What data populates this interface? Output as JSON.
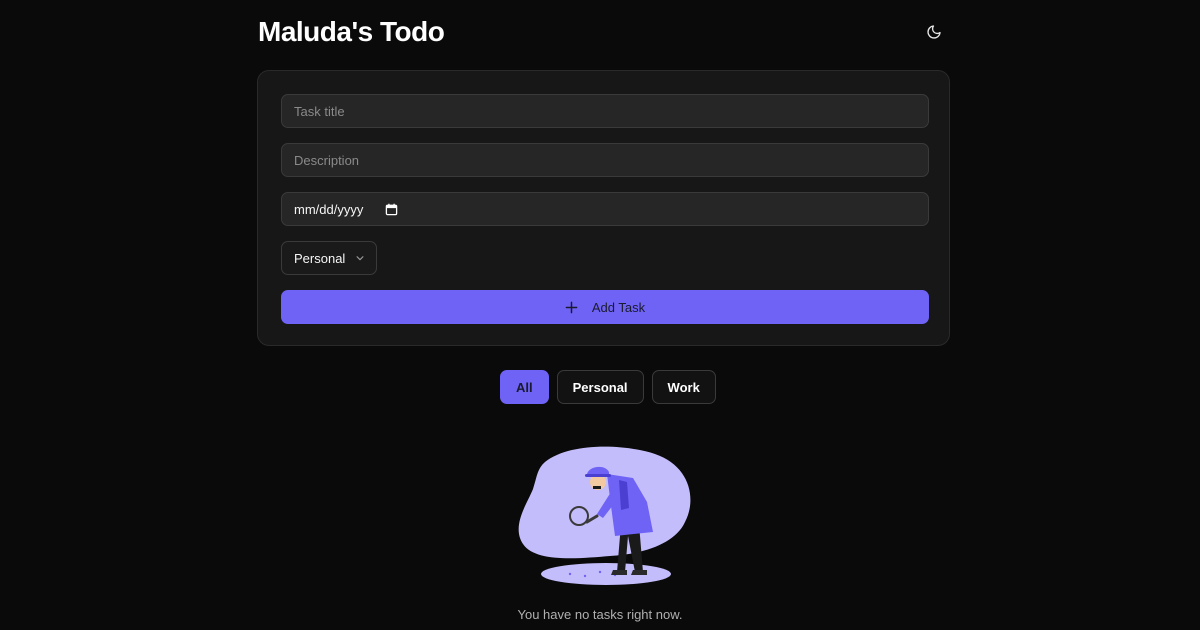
{
  "header": {
    "title": "Maluda's Todo",
    "theme_icon": "moon-icon"
  },
  "form": {
    "title_placeholder": "Task title",
    "description_placeholder": "Description",
    "date_placeholder": "mm/dd/yyyy",
    "category_selected": "Personal",
    "add_button_label": "Add Task",
    "add_button_icon": "plus-icon"
  },
  "filters": [
    {
      "label": "All",
      "active": true
    },
    {
      "label": "Personal",
      "active": false
    },
    {
      "label": "Work",
      "active": false
    }
  ],
  "empty_state": {
    "message": "You have no tasks right now.",
    "illustration": "detective-searching-illustration"
  },
  "colors": {
    "accent": "#6f63f6",
    "background": "#0a0a0a",
    "card": "#171717"
  }
}
